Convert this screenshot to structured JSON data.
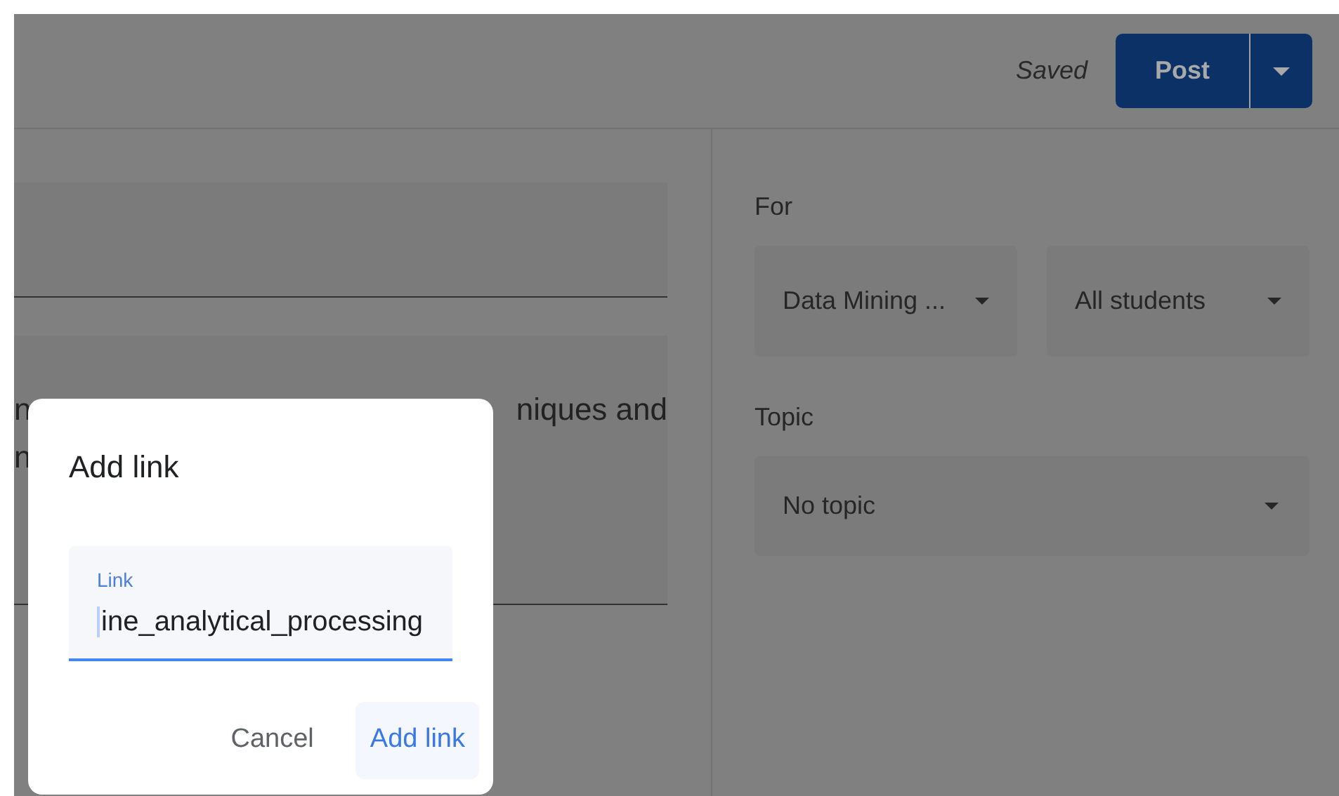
{
  "header": {
    "status": "Saved",
    "post_button": "Post"
  },
  "description": {
    "line_1_left": "n",
    "line_1_right": "niques and",
    "line_2_left": "n"
  },
  "sidebar": {
    "for_label": "For",
    "for_selects": [
      {
        "value": "Data Mining ..."
      },
      {
        "value": "All students"
      }
    ],
    "topic_label": "Topic",
    "topic_select": {
      "value": "No topic"
    }
  },
  "dialog": {
    "title": "Add link",
    "field": {
      "label": "Link",
      "value": "ine_analytical_processing",
      "focused": true
    },
    "buttons": [
      {
        "label": "Cancel",
        "kind": "text"
      },
      {
        "label": "Add link",
        "kind": "primary"
      }
    ]
  }
}
